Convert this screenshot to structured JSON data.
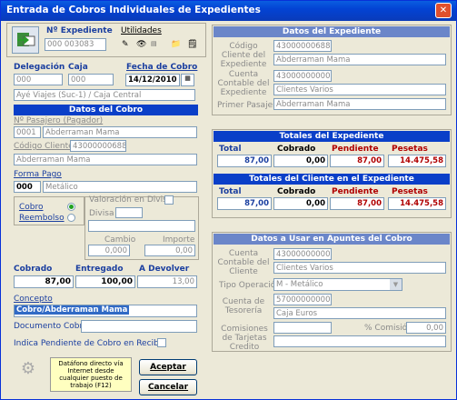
{
  "window": {
    "title": "Entrada de Cobros Individuales de Expedientes"
  },
  "header": {
    "nexp_label": "Nº Expediente",
    "nexp_value": "000 003083",
    "utilidades": "Utilidades"
  },
  "left": {
    "delegacion_label": "Delegación",
    "delegacion": "000",
    "caja_label": "Caja",
    "caja": "000",
    "fecha_label": "Fecha de Cobro",
    "fecha": "14/12/2010",
    "agencia": "Ayé Viajes (Suc-1) / Caja Central",
    "datos_cobro": "Datos del Cobro",
    "pasajero_label": "Nº Pasajero (Pagador)",
    "pasajero_num": "0001",
    "pasajero_name": "Abderraman Mama",
    "codcli_label": "Código Cliente",
    "codcli": "43000000688",
    "codcli_name": "Abderraman Mama",
    "formapago_label": "Forma Pago",
    "formapago_code": "000",
    "formapago_name": "Metálico",
    "cobro_label": "Cobro",
    "reembolso_label": "Reembolso",
    "valoracion_label": "Valoración en Divisa",
    "divisa_label": "Divisa",
    "cambio_label": "Cambio",
    "importe_label": "Importe",
    "cambio": "0,000",
    "importe": "0,00",
    "cobrado_label": "Cobrado",
    "entregado_label": "Entregado",
    "devolver_label": "A Devolver",
    "cobrado": "87,00",
    "entregado": "100,00",
    "devolver": "13,00",
    "concepto_label": "Concepto",
    "concepto": "Cobro/Abderraman Mama",
    "doccobro_label": "Documento Cobro",
    "pendiente_label": "Indica Pendiente de Cobro en Recibo",
    "datafono": "Datáfono directo vía Internet desde cualquier puesto de trabajo (F12)",
    "aceptar": "Aceptar",
    "cancelar": "Cancelar"
  },
  "right": {
    "datos_exp": "Datos del Expediente",
    "codcli_label": "Código Cliente del Expediente",
    "codcli": "43000000688",
    "codcli_name": "Abderraman Mama",
    "cuenta_label": "Cuenta Contable del Expediente",
    "cuenta": "43000000000",
    "cuenta_name": "Clientes Varios",
    "primer_label": "Primer Pasajero",
    "primer": "Abderraman Mama",
    "totales_exp": "Totales del Expediente",
    "totales_cli": "Totales del Cliente en el Expediente",
    "cols": [
      "Total",
      "Cobrado",
      "Pendiente",
      "Pesetas"
    ],
    "exp_vals": [
      "87,00",
      "0,00",
      "87,00",
      "14.475,58"
    ],
    "cli_vals": [
      "87,00",
      "0,00",
      "87,00",
      "14.475,58"
    ],
    "apuntes": "Datos a Usar en Apuntes del Cobro",
    "cc_label": "Cuenta Contable del Cliente",
    "cc": "43000000000",
    "cc_name": "Clientes Varios",
    "tipo_label": "Tipo Operación",
    "tipo": "M - Metálico",
    "tes_label": "Cuenta de Tesorería",
    "tes": "57000000000",
    "tes_name": "Caja Euros",
    "com_label": "Comisiones de Tarjetas Credito",
    "pcom_label": "% Comisión",
    "pcom": "0,00"
  }
}
